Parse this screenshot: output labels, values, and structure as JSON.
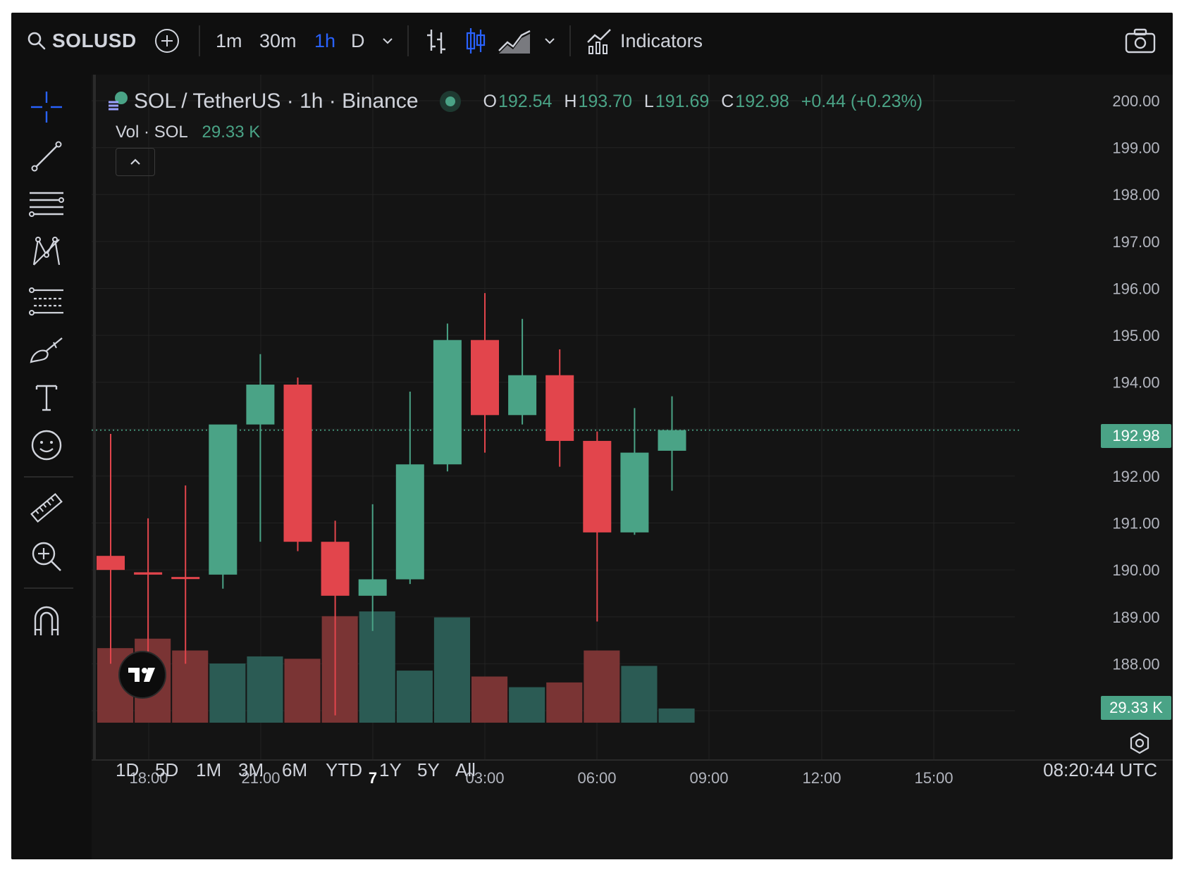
{
  "topbar": {
    "symbol": "SOLUSD",
    "timeframes": [
      "1m",
      "30m",
      "1h",
      "D"
    ],
    "active_timeframe": "1h",
    "indicators_label": "Indicators"
  },
  "legend": {
    "title": "SOL / TetherUS · 1h · Binance",
    "o_key": "O",
    "o_val": "192.54",
    "h_key": "H",
    "h_val": "193.70",
    "l_key": "L",
    "l_val": "191.69",
    "c_key": "C",
    "c_val": "192.98",
    "change": "+0.44 (+0.23%)",
    "vol_label": "Vol · SOL",
    "vol_value": "29.33 K"
  },
  "price_axis": {
    "ticks": [
      "200.00",
      "199.00",
      "198.00",
      "197.00",
      "196.00",
      "195.00",
      "194.00",
      "193.00",
      "192.00",
      "191.00",
      "190.00",
      "189.00",
      "188.00",
      "187.00"
    ],
    "last_price_label": "192.98",
    "last_volume_label": "29.33 K"
  },
  "time_axis": {
    "ticks": [
      "18:00",
      "21:00",
      "7",
      "03:00",
      "06:00",
      "09:00",
      "12:00",
      "15:00"
    ]
  },
  "ranges": [
    "1D",
    "5D",
    "1M",
    "3M",
    "6M",
    "YTD",
    "1Y",
    "5Y",
    "All"
  ],
  "clock": "08:20:44 UTC",
  "colors": {
    "up": "#4aa386",
    "down": "#e2454c",
    "up_vol": "#2b5b54",
    "down_vol": "#7a3434",
    "accent": "#2962ff"
  },
  "chart_data": {
    "type": "candlestick",
    "ylim": [
      186.8,
      200.2
    ],
    "last_price": 192.98,
    "candles": [
      {
        "o": 190.3,
        "h": 192.9,
        "l": 188.0,
        "c": 190.0,
        "v": 0.63
      },
      {
        "o": 189.95,
        "h": 191.1,
        "l": 187.4,
        "c": 189.9,
        "v": 0.71
      },
      {
        "o": 189.85,
        "h": 191.8,
        "l": 188.0,
        "c": 189.82,
        "v": 0.61
      },
      {
        "o": 189.9,
        "h": 192.4,
        "l": 189.6,
        "c": 193.1,
        "v": 0.5
      },
      {
        "o": 193.1,
        "h": 194.6,
        "l": 190.6,
        "c": 193.95,
        "v": 0.56
      },
      {
        "o": 193.95,
        "h": 194.1,
        "l": 190.4,
        "c": 190.6,
        "v": 0.54
      },
      {
        "o": 190.6,
        "h": 191.05,
        "l": 186.9,
        "c": 189.45,
        "v": 0.9
      },
      {
        "o": 189.45,
        "h": 191.4,
        "l": 188.7,
        "c": 189.8,
        "v": 0.94
      },
      {
        "o": 189.8,
        "h": 193.8,
        "l": 189.7,
        "c": 192.25,
        "v": 0.44
      },
      {
        "o": 192.25,
        "h": 195.25,
        "l": 192.1,
        "c": 194.9,
        "v": 0.89
      },
      {
        "o": 194.9,
        "h": 195.9,
        "l": 192.5,
        "c": 193.3,
        "v": 0.39
      },
      {
        "o": 193.3,
        "h": 195.35,
        "l": 193.1,
        "c": 194.15,
        "v": 0.3
      },
      {
        "o": 194.15,
        "h": 194.7,
        "l": 192.2,
        "c": 192.75,
        "v": 0.34
      },
      {
        "o": 192.75,
        "h": 192.95,
        "l": 188.9,
        "c": 190.8,
        "v": 0.61
      },
      {
        "o": 190.8,
        "h": 193.45,
        "l": 190.75,
        "c": 192.5,
        "v": 0.48
      },
      {
        "o": 192.54,
        "h": 193.7,
        "l": 191.69,
        "c": 192.98,
        "v": 0.12
      }
    ]
  }
}
